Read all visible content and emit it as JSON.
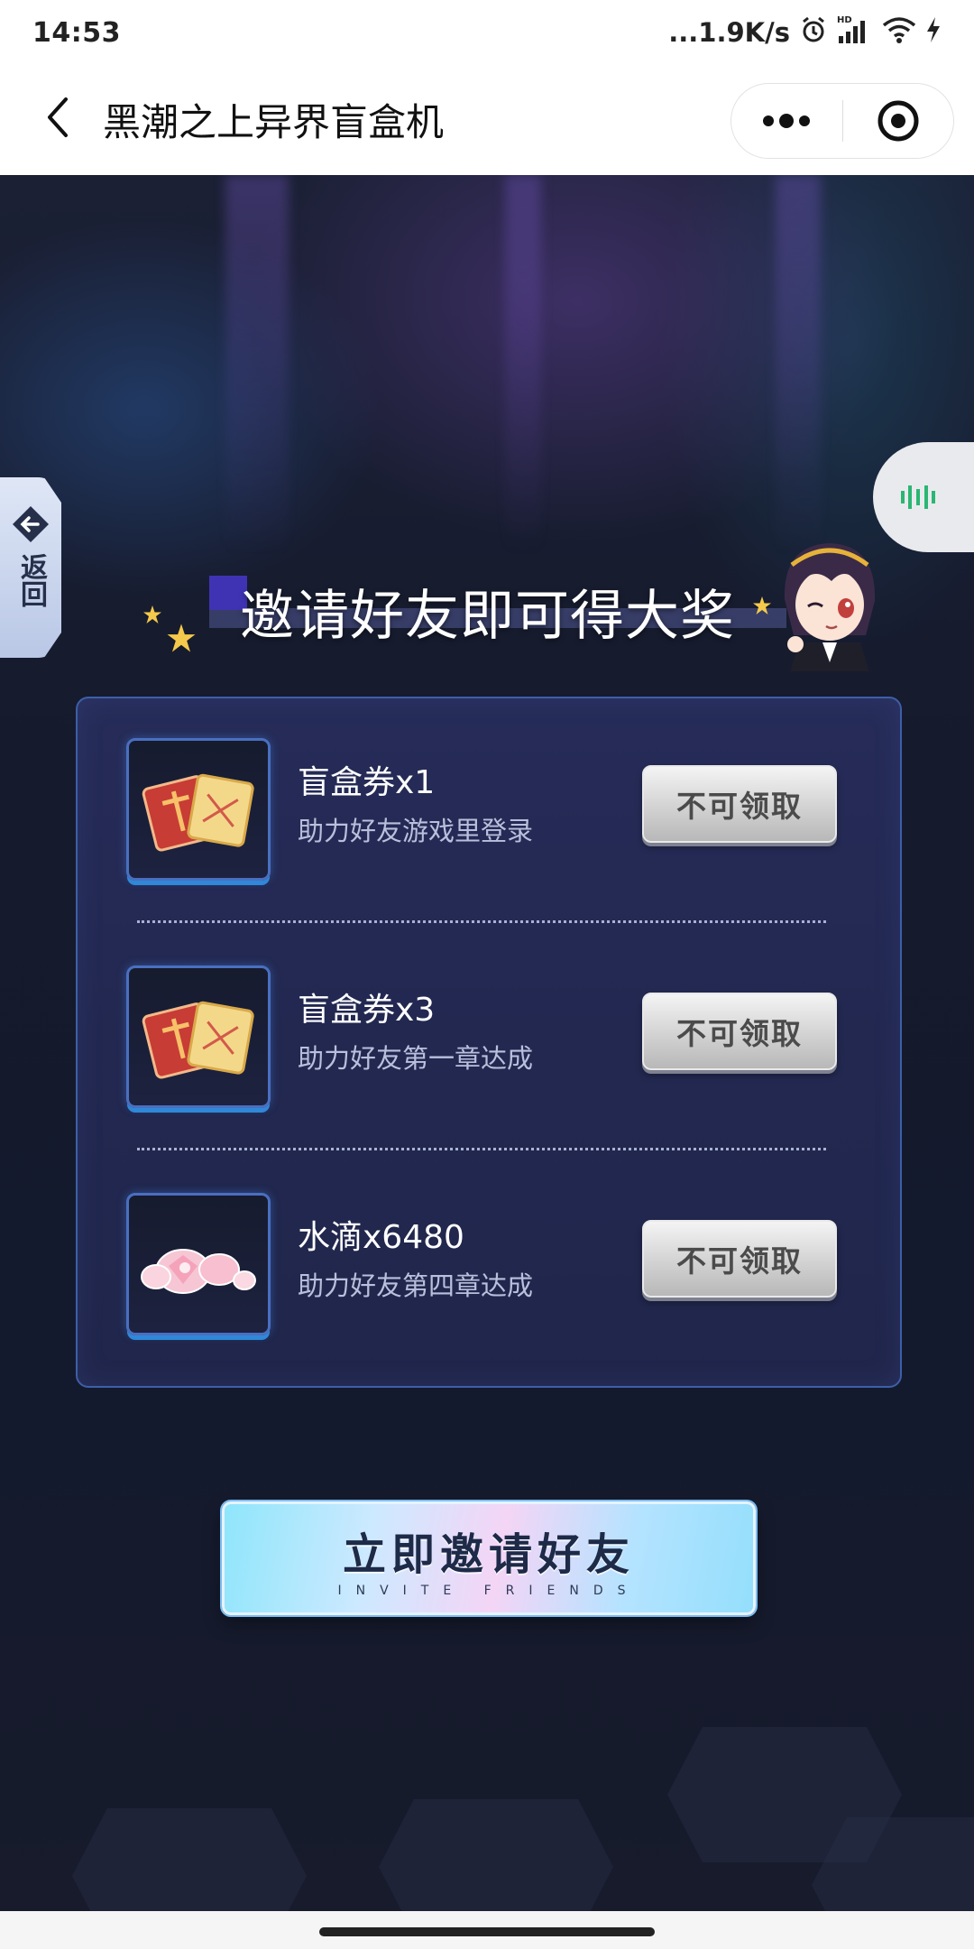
{
  "status_bar": {
    "time": "14:53",
    "network_speed": "...1.9K/s",
    "hd_label": "HD"
  },
  "nav": {
    "title": "黑潮之上异界盲盒机"
  },
  "side_tab": {
    "label": "返回"
  },
  "headline": "邀请好友即可得大奖",
  "rewards": [
    {
      "title": "盲盒券x1",
      "desc": "助力好友游戏里登录",
      "button": "不可领取",
      "icon": "ticket-icon"
    },
    {
      "title": "盲盒券x3",
      "desc": "助力好友第一章达成",
      "button": "不可领取",
      "icon": "ticket-icon"
    },
    {
      "title": "水滴x6480",
      "desc": "助力好友第四章达成",
      "button": "不可领取",
      "icon": "crystal-drops-icon"
    }
  ],
  "invite": {
    "label": "立即邀请好友",
    "sub_label": "INVITE FRIENDS"
  },
  "colors": {
    "accent_green": "#3cc21c",
    "card_border": "#3d5fa8",
    "page_bg": "#14182b"
  }
}
